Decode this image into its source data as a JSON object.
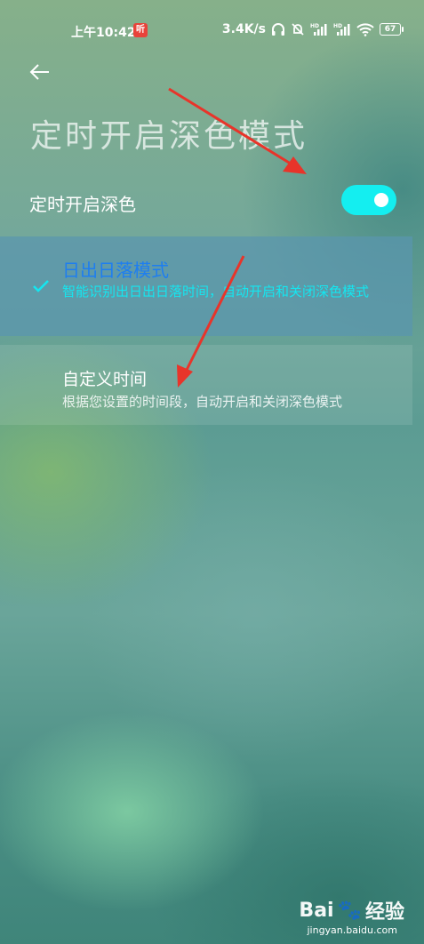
{
  "status_bar": {
    "time": "上午10:42",
    "app_badge": "听",
    "network_speed": "3.4K/s",
    "signal1": "HD",
    "signal2": "HD",
    "battery": "67"
  },
  "header": {
    "back_icon": "arrow-left-icon",
    "title": "定时开启深色模式"
  },
  "schedule_toggle": {
    "label": "定时开启深色",
    "enabled": true,
    "accent": "#14eef0"
  },
  "options": [
    {
      "title": "日出日落模式",
      "subtitle": "智能识别出日出日落时间，自动开启和关闭深色模式",
      "selected": true,
      "title_color": "#1e7ef0",
      "subtitle_color": "#14e6f0"
    },
    {
      "title": "自定义时间",
      "subtitle": "根据您设置的时间段，自动开启和关闭深色模式",
      "selected": false
    }
  ],
  "watermark": {
    "brand": "Bai",
    "brand_suffix": "经验",
    "url": "jingyan.baidu.com"
  },
  "annotation_color": "#e8342a"
}
